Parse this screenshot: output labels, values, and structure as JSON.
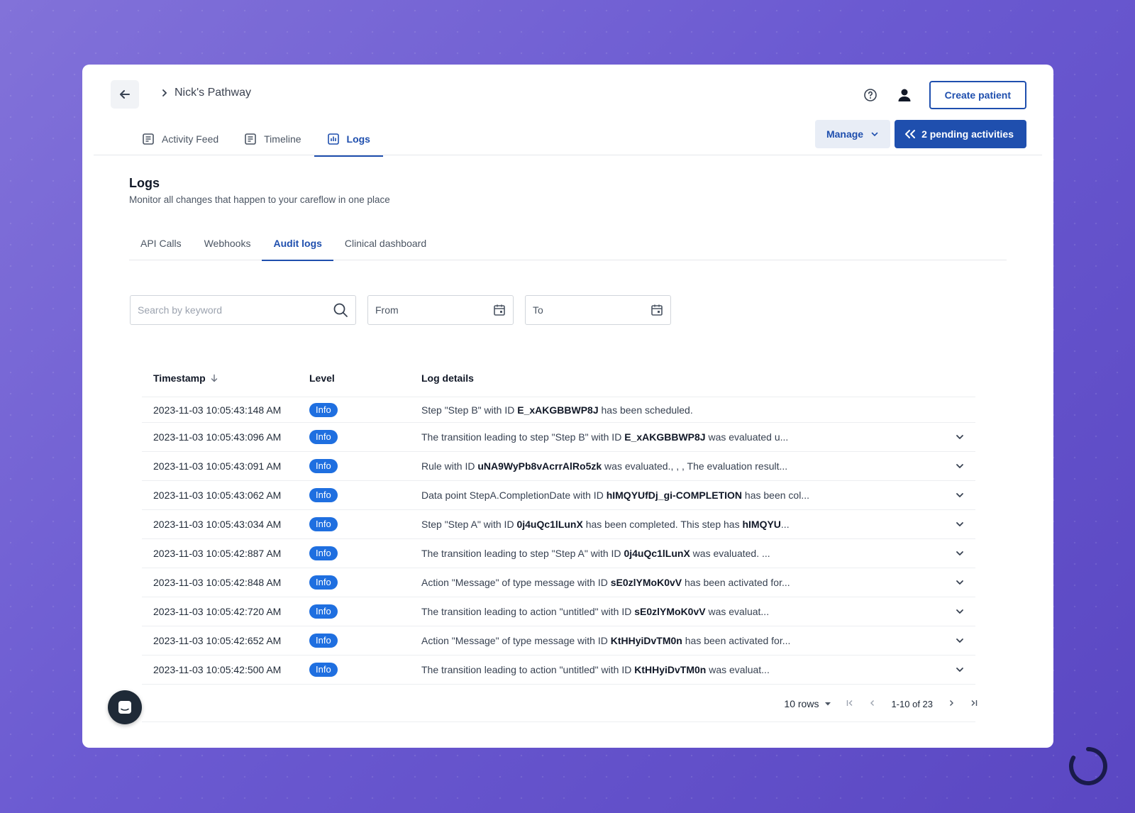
{
  "header": {
    "breadcrumb": "Nick's Pathway",
    "create_patient": "Create patient"
  },
  "main_tabs": [
    {
      "label": "Activity Feed",
      "icon": "document-list-icon"
    },
    {
      "label": "Timeline",
      "icon": "document-list-icon"
    },
    {
      "label": "Logs",
      "icon": "bar-chart-icon",
      "active": true
    }
  ],
  "actions": {
    "manage": "Manage",
    "pending": "2 pending activities"
  },
  "logs": {
    "title": "Logs",
    "subtitle": "Monitor all changes that happen to your careflow in one place"
  },
  "sub_tabs": [
    {
      "label": "API Calls"
    },
    {
      "label": "Webhooks"
    },
    {
      "label": "Audit logs",
      "active": true
    },
    {
      "label": "Clinical dashboard"
    }
  ],
  "filters": {
    "search_placeholder": "Search by keyword",
    "from": "From",
    "to": "To"
  },
  "table": {
    "headers": {
      "timestamp": "Timestamp",
      "level": "Level",
      "details": "Log details"
    },
    "rows": [
      {
        "timestamp": "2023-11-03 10:05:43:148 AM",
        "level": "Info",
        "pre": "Step \"Step B\" with ID ",
        "bold": "E_xAKGBBWP8J",
        "post": " has been scheduled.",
        "expandable": false
      },
      {
        "timestamp": "2023-11-03 10:05:43:096 AM",
        "level": "Info",
        "pre": "The transition leading to step \"Step B\" with ID ",
        "bold": "E_xAKGBBWP8J",
        "post": " was evaluated u...",
        "expandable": true
      },
      {
        "timestamp": "2023-11-03 10:05:43:091 AM",
        "level": "Info",
        "pre": "Rule with ID ",
        "bold": "uNA9WyPb8vAcrrAlRo5zk",
        "post": " was evaluated., , , The evaluation result...",
        "expandable": true
      },
      {
        "timestamp": "2023-11-03 10:05:43:062 AM",
        "level": "Info",
        "pre": "Data point StepA.CompletionDate with ID ",
        "bold": "hIMQYUfDj_gi-COMPLETION",
        "post": " has been col...",
        "expandable": true
      },
      {
        "timestamp": "2023-11-03 10:05:43:034 AM",
        "level": "Info",
        "pre": "Step \"Step A\" with ID ",
        "bold": "0j4uQc1lLunX",
        "post": " has been completed. This step has ",
        "bold2": "hIMQYU",
        "post2": "...",
        "expandable": true
      },
      {
        "timestamp": "2023-11-03 10:05:42:887 AM",
        "level": "Info",
        "pre": "The transition leading to step \"Step A\" with ID ",
        "bold": "0j4uQc1lLunX",
        "post": " was evaluated. ...",
        "expandable": true
      },
      {
        "timestamp": "2023-11-03 10:05:42:848 AM",
        "level": "Info",
        "pre": "Action \"Message\" of type message with ID ",
        "bold": "sE0zlYMoK0vV",
        "post": " has been activated for...",
        "expandable": true
      },
      {
        "timestamp": "2023-11-03 10:05:42:720 AM",
        "level": "Info",
        "pre": "The transition leading to action \"untitled\" with ID ",
        "bold": "sE0zlYMoK0vV",
        "post": " was evaluat...",
        "expandable": true
      },
      {
        "timestamp": "2023-11-03 10:05:42:652 AM",
        "level": "Info",
        "pre": "Action \"Message\" of type message with ID ",
        "bold": "KtHHyiDvTM0n",
        "post": " has been activated for...",
        "expandable": true
      },
      {
        "timestamp": "2023-11-03 10:05:42:500 AM",
        "level": "Info",
        "pre": "The transition leading to action \"untitled\" with ID ",
        "bold": "KtHHyiDvTM0n",
        "post": " was evaluat...",
        "expandable": true
      }
    ]
  },
  "pagination": {
    "rows": "10 rows",
    "range": "1-10 of 23"
  },
  "colors": {
    "primary": "#1f4fae",
    "badge": "#1f6fe0",
    "background_start": "#8272d9",
    "background_end": "#5a47c2"
  }
}
